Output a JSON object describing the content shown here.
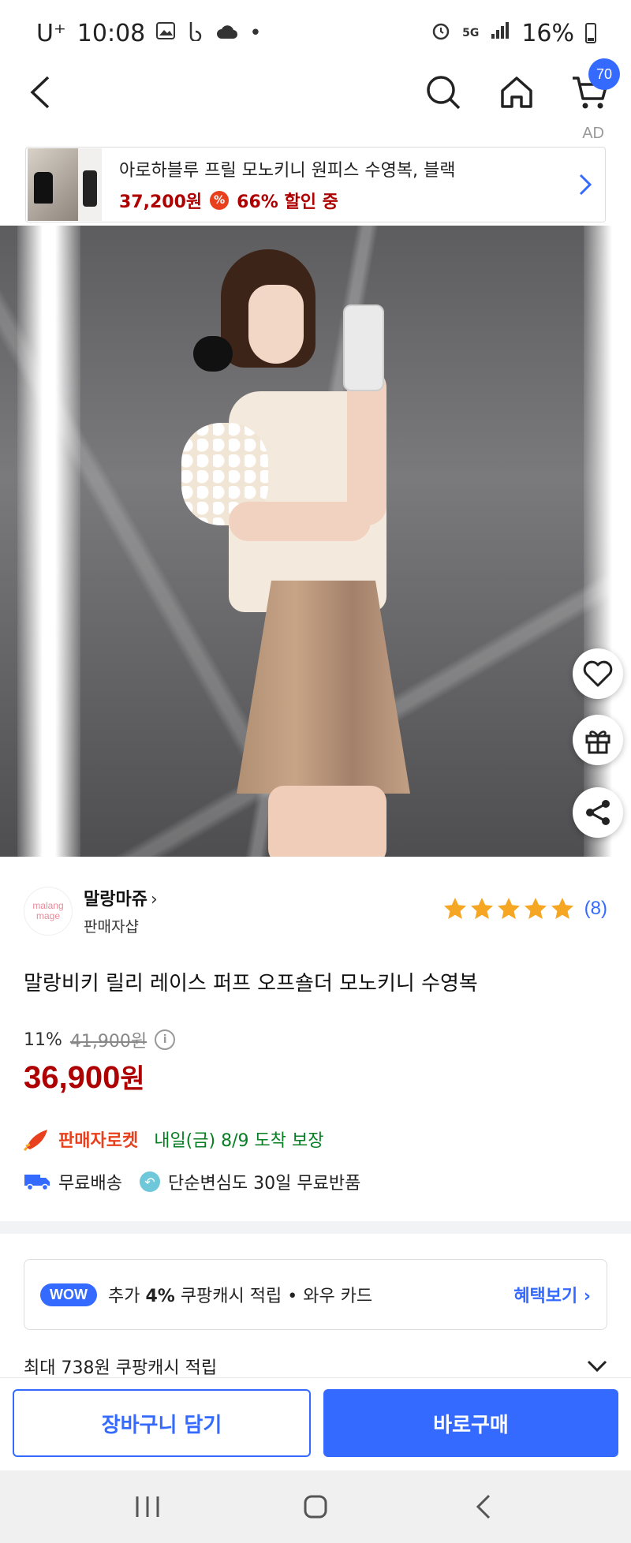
{
  "status_bar": {
    "carrier": "U⁺",
    "time": "10:08",
    "network": "5G",
    "battery": "16%"
  },
  "nav": {
    "cart_count": "70"
  },
  "ad": {
    "label": "AD",
    "title": "아로하블루 프릴 모노키니 원피스 수영복, 블랙",
    "price": "37,200원",
    "discount": "66% 할인 중",
    "discount_icon": "%"
  },
  "seller": {
    "logo_line1": "malang",
    "logo_line2": "mage",
    "name": "말랑마쥬",
    "chevron": "›",
    "subtitle": "판매자샵",
    "rating_stars": 5,
    "review_count": "(8)"
  },
  "product": {
    "title": "말랑비키 릴리 레이스 퍼프 오프숄더 모노키니 수영복",
    "discount_rate": "11%",
    "original_price": "41,900원",
    "sale_price_number": "36,900",
    "sale_price_unit": "원"
  },
  "delivery": {
    "rocket_label": "판매자로켓",
    "arrival": "내일(금) 8/9 도착 보장",
    "free_shipping": "무료배송",
    "free_return": "단순변심도 30일 무료반품"
  },
  "wow": {
    "badge": "WOW",
    "text_prefix": "추가 ",
    "text_bold": "4%",
    "text_suffix": " 쿠팡캐시 적립  •  와우 카드",
    "link": "혜택보기 ›"
  },
  "cashback": {
    "text": "최대 738원 쿠팡캐시 적립"
  },
  "actions": {
    "add_to_cart": "장바구니 담기",
    "buy_now": "바로구매"
  },
  "colors": {
    "accent": "#346aff",
    "price_red": "#ae0000",
    "rocket_orange": "#e8401c",
    "arrival_green": "#087e22",
    "star": "#f5a623"
  }
}
